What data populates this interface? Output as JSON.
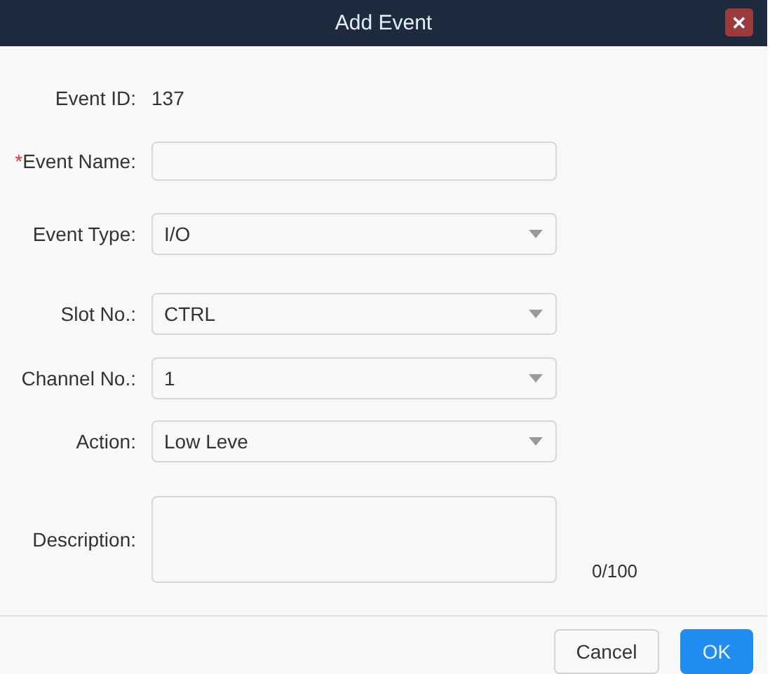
{
  "window": {
    "title": "Add Event",
    "close_label": "✕"
  },
  "fields": [
    {
      "kind": "static",
      "label": "Event ID:",
      "value": "137"
    },
    {
      "kind": "text",
      "label": "Event Name:",
      "required_mark": "*"
    },
    {
      "kind": "select",
      "label": "Event Type:",
      "value": "I/O"
    },
    {
      "kind": "select",
      "label": "Slot No.:",
      "value": "CTRL"
    },
    {
      "kind": "select",
      "label": "Channel No.:",
      "value": "1"
    },
    {
      "kind": "select",
      "label": "Action:",
      "value": "Low Leve"
    },
    {
      "kind": "textarea",
      "label": "Description:",
      "counter": "0/100"
    }
  ],
  "buttons": [
    {
      "label": "Cancel",
      "kind": "default"
    },
    {
      "label": "OK",
      "kind": "primary"
    }
  ]
}
